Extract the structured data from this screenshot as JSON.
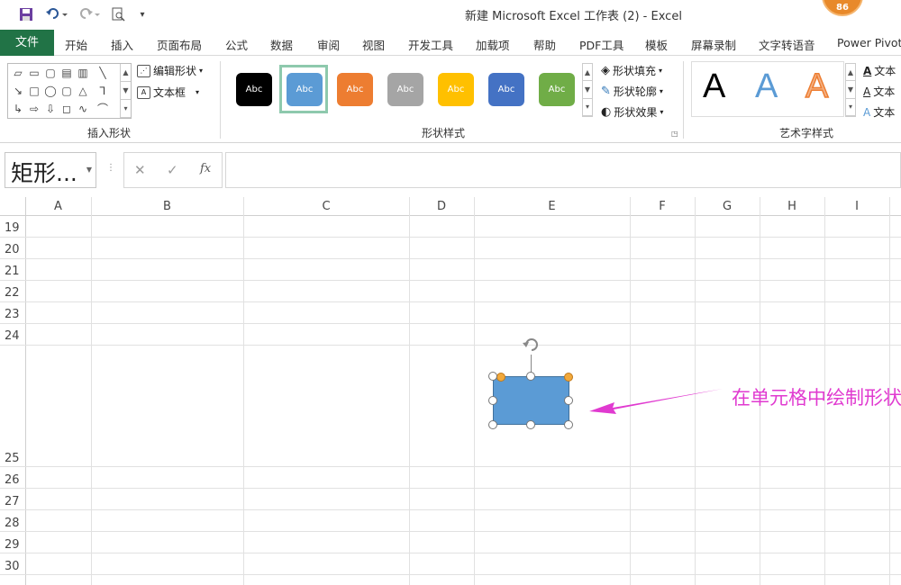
{
  "window_title": "新建 Microsoft Excel 工作表 (2)  -  Excel",
  "user_badge": "86",
  "menu": {
    "file": "文件",
    "tabs": [
      "开始",
      "插入",
      "页面布局",
      "公式",
      "数据",
      "审阅",
      "视图",
      "开发工具",
      "加载项",
      "帮助",
      "PDF工具",
      "模板",
      "屏幕录制",
      "文字转语音",
      "Power Pivot"
    ]
  },
  "ribbon": {
    "insert_shapes": {
      "label": "插入形状",
      "edit_shape": "编辑形状",
      "text_box": "文本框"
    },
    "shape_styles": {
      "label": "形状样式",
      "swatch_text": "Abc",
      "swatch_colors": [
        "#000000",
        "#5b9bd5",
        "#ed7d31",
        "#a5a5a5",
        "#ffc000",
        "#4472c4",
        "#70ad47"
      ],
      "fill": "形状填充",
      "outline": "形状轮廓",
      "effects": "形状效果"
    },
    "wordart": {
      "label": "艺术字样式",
      "samples": [
        "A",
        "A",
        "A"
      ],
      "fill": "文本",
      "outline": "文本",
      "effects": "文本"
    }
  },
  "formula_bar": {
    "name_box": "矩形...",
    "cancel": "✕",
    "enter": "✓",
    "fx": "fx",
    "value": ""
  },
  "sheet": {
    "columns": [
      "A",
      "B",
      "C",
      "D",
      "E",
      "F",
      "G",
      "H",
      "I"
    ],
    "rows": [
      "19",
      "20",
      "21",
      "22",
      "23",
      "24",
      "25",
      "26",
      "27",
      "28",
      "29",
      "30"
    ]
  },
  "annotation": {
    "text": "在单元格中绘制形状",
    "color": "#e03ad0"
  },
  "colors": {
    "accent": "#217346",
    "shape_fill": "#5b9bd5"
  }
}
